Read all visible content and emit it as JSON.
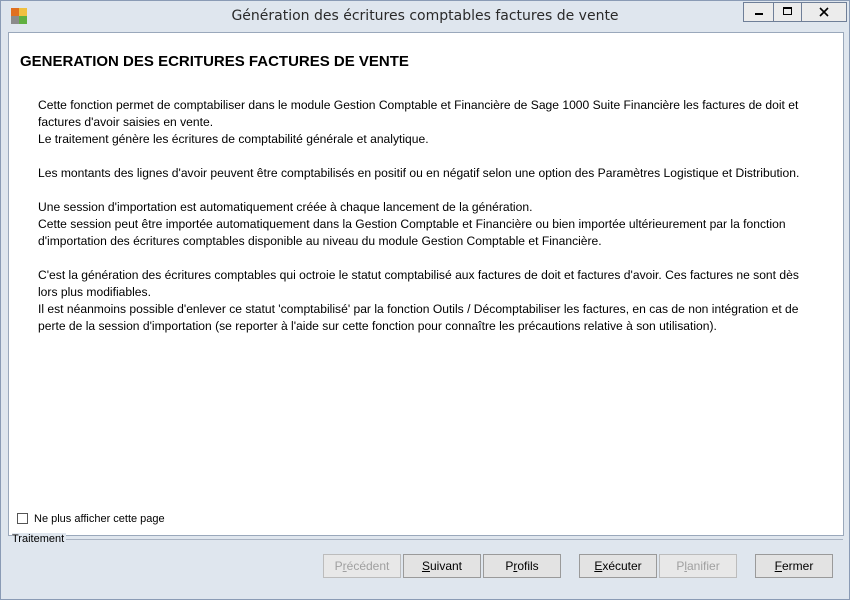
{
  "window": {
    "title": "Génération des écritures comptables factures de vente"
  },
  "page": {
    "heading": "GENERATION DES ECRITURES FACTURES DE VENTE",
    "paragraphs": [
      [
        "Cette fonction permet de comptabiliser dans le module Gestion Comptable et Financière de Sage 1000 Suite Financière les factures de doit et factures d'avoir saisies en vente.",
        "Le traitement génère les écritures de comptabilité générale et analytique."
      ],
      [
        "Les montants des lignes d'avoir peuvent être comptabilisés en positif ou en négatif selon une option des Paramètres Logistique et Distribution."
      ],
      [
        "Une session d'importation est automatiquement créée à chaque lancement de la génération.",
        "Cette session peut être importée automatiquement dans la Gestion Comptable et Financière ou bien importée ultérieurement par la fonction d'importation des écritures comptables disponible au niveau du module Gestion Comptable et Financière."
      ],
      [
        "C'est la génération des écritures comptables qui octroie le statut comptabilisé aux factures de doit et factures d'avoir. Ces factures ne sont dès lors plus modifiables.",
        "Il est néanmoins possible d'enlever ce statut 'comptabilisé' par la fonction Outils / Décomptabiliser les factures, en cas de non intégration et de perte de la session d'importation (se reporter à l'aide sur cette fonction pour connaître les précautions relative à son utilisation)."
      ]
    ]
  },
  "options": {
    "hide_page_label": "Ne plus afficher cette page",
    "hide_page_checked": false
  },
  "group": {
    "label": "Traitement"
  },
  "buttons": {
    "previous": {
      "pre": "P",
      "key": "r",
      "post": "écédent",
      "enabled": false
    },
    "next": {
      "pre": "",
      "key": "S",
      "post": "uivant",
      "enabled": true
    },
    "profiles": {
      "pre": "P",
      "key": "r",
      "post": "ofils",
      "enabled": true
    },
    "execute": {
      "pre": "",
      "key": "E",
      "post": "xécuter",
      "enabled": true
    },
    "schedule": {
      "pre": "P",
      "key": "l",
      "post": "anifier",
      "enabled": false
    },
    "close": {
      "pre": "",
      "key": "F",
      "post": "ermer",
      "enabled": true
    }
  },
  "colors": {
    "chrome": "#dfe6ee",
    "content_bg": "#ffffff",
    "button_bg": "#e3e3e3",
    "disabled_text": "#a0a0a0"
  },
  "icons": {
    "app": "app-logo-icon",
    "minimize": "minimize-icon",
    "maximize": "maximize-icon",
    "close": "close-icon",
    "checkbox": "checkbox-icon"
  }
}
